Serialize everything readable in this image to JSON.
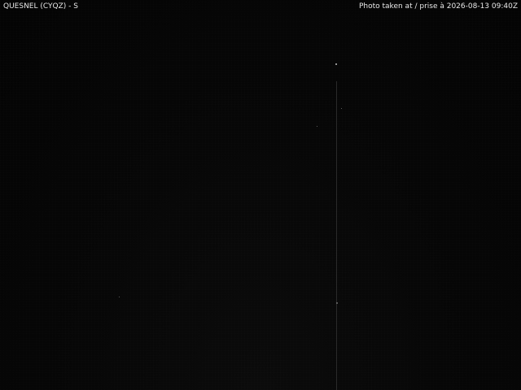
{
  "camera": {
    "station_label": "QUESNEL (CYQZ) - S",
    "timestamp_label": "Photo taken at / prise à 2026-08-13 09:40Z"
  }
}
